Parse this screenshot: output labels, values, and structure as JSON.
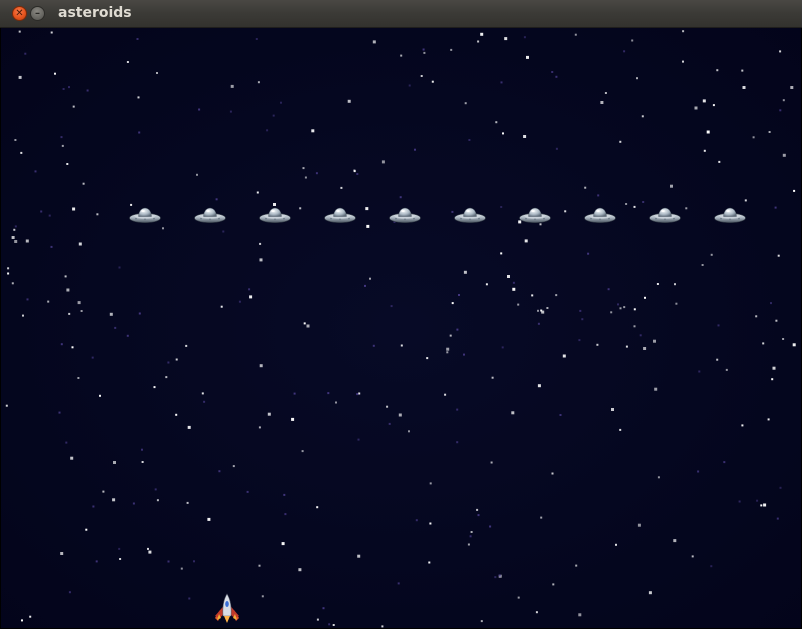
{
  "window": {
    "title": "asteroids",
    "close_icon": "close-x",
    "minimize_icon": "minimize-dash"
  },
  "game": {
    "colors": {
      "space_background": "#05061e",
      "star": "#ffffff",
      "ufo_hull": "#b9c2cc",
      "ship_flame": "#e0542a"
    },
    "enemy_count": 10,
    "enemy_sprite": "flying-saucer-icon",
    "player_sprite": "rocket-ship-icon"
  }
}
